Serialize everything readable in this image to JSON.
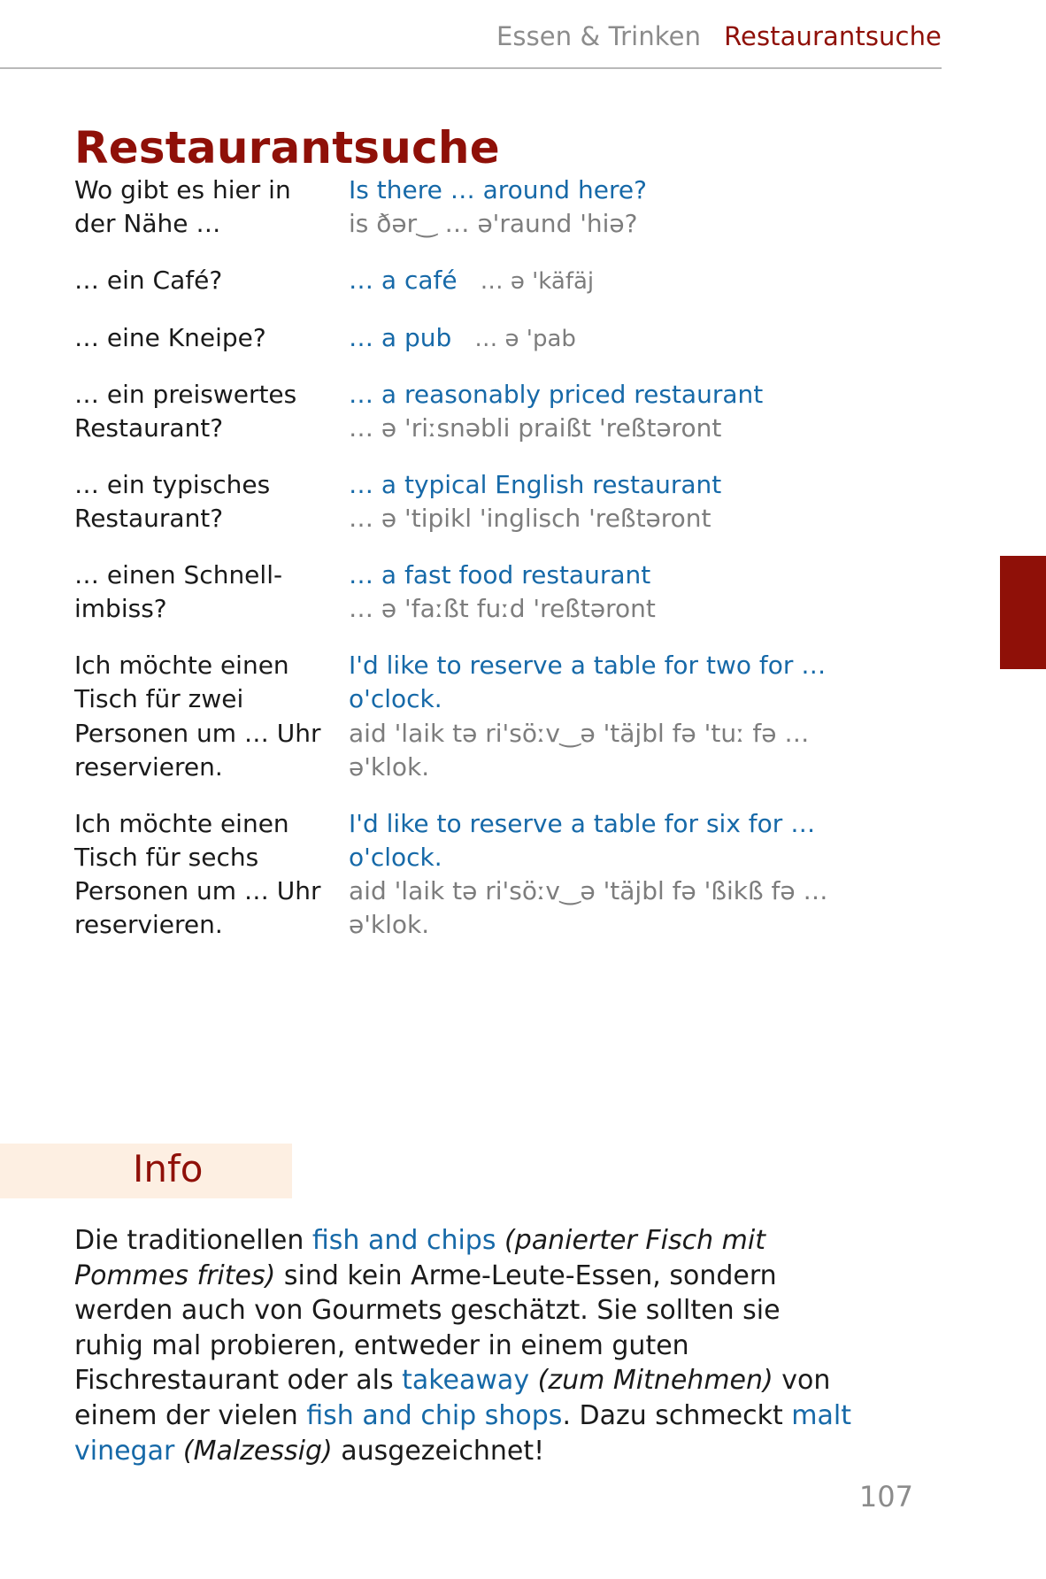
{
  "running_head": {
    "chapter": "Essen & Trinken",
    "section": "Restaurantsuche"
  },
  "page_title": "Restaurantsuche",
  "colors": {
    "accent_red": "#8f1008",
    "link_blue": "#1669a8",
    "phonetic_gray": "#7d7d7d",
    "info_band": "#fdefe2",
    "rule_gray": "#b9b9b9"
  },
  "phrases": [
    {
      "german": "Wo gibt es hier in der Nähe …",
      "english": "Is there … around here?",
      "phonetic": "is ðər‿ … ə'raund 'hiə?",
      "layout": "stacked"
    },
    {
      "german": "… ein Café?",
      "english": "… a café",
      "phonetic": "… ə 'käfäj",
      "layout": "inline"
    },
    {
      "german": "… eine Kneipe?",
      "english": "… a pub",
      "phonetic": "… ə 'pab",
      "layout": "inline"
    },
    {
      "german": "… ein preiswertes Restaurant?",
      "english": "… a reasonably priced restaurant",
      "phonetic": "… ə 'riːsnəbli praißt 'reßtəront",
      "layout": "stacked"
    },
    {
      "german": "… ein typisches Restaurant?",
      "english": "… a typical English restaurant",
      "phonetic": "… ə 'tipikl 'inglisch 'reßtəront",
      "layout": "stacked"
    },
    {
      "german": "… einen Schnell-imbiss?",
      "english": "… a fast food restaurant",
      "phonetic": "… ə 'faːßt fuːd 'reßtəront",
      "layout": "stacked"
    },
    {
      "german": "Ich möchte einen Tisch für zwei Personen um … Uhr reservieren.",
      "english": "I'd like to reserve a table for two for … o'clock.",
      "phonetic": "aid 'laik tə ri'söːv‿ə 'täjbl fə 'tuː fə … ə'klok.",
      "layout": "stacked"
    },
    {
      "german": "Ich möchte einen Tisch für sechs Personen um … Uhr reservieren.",
      "english": "I'd like to reserve a table for six for … o'clock.",
      "phonetic": "aid 'laik tə ri'söːv‿ə 'täjbl fə 'ßikß fə … ə'klok.",
      "layout": "stacked"
    }
  ],
  "info": {
    "title": "Info",
    "segments": [
      {
        "text": "Die traditionellen ",
        "style": "plain"
      },
      {
        "text": "fish and chips",
        "style": "term"
      },
      {
        "text": " ",
        "style": "plain"
      },
      {
        "text": "(panierter Fisch mit Pommes frites)",
        "style": "gloss"
      },
      {
        "text": " sind kein Arme-Leute-Essen, sondern werden auch von Gourmets geschätzt. Sie sollten sie ruhig mal probieren, entweder in einem guten Fischrestaurant oder als ",
        "style": "plain"
      },
      {
        "text": "takeaway",
        "style": "term"
      },
      {
        "text": " ",
        "style": "plain"
      },
      {
        "text": "(zum Mitnehmen)",
        "style": "gloss"
      },
      {
        "text": " von einem der vielen ",
        "style": "plain"
      },
      {
        "text": "fish and chip shops",
        "style": "term"
      },
      {
        "text": ". Dazu schmeckt ",
        "style": "plain"
      },
      {
        "text": "malt vinegar",
        "style": "term"
      },
      {
        "text": " ",
        "style": "plain"
      },
      {
        "text": "(Malzessig)",
        "style": "gloss"
      },
      {
        "text": " ausgezeichnet!",
        "style": "plain"
      }
    ]
  },
  "page_number": "107"
}
